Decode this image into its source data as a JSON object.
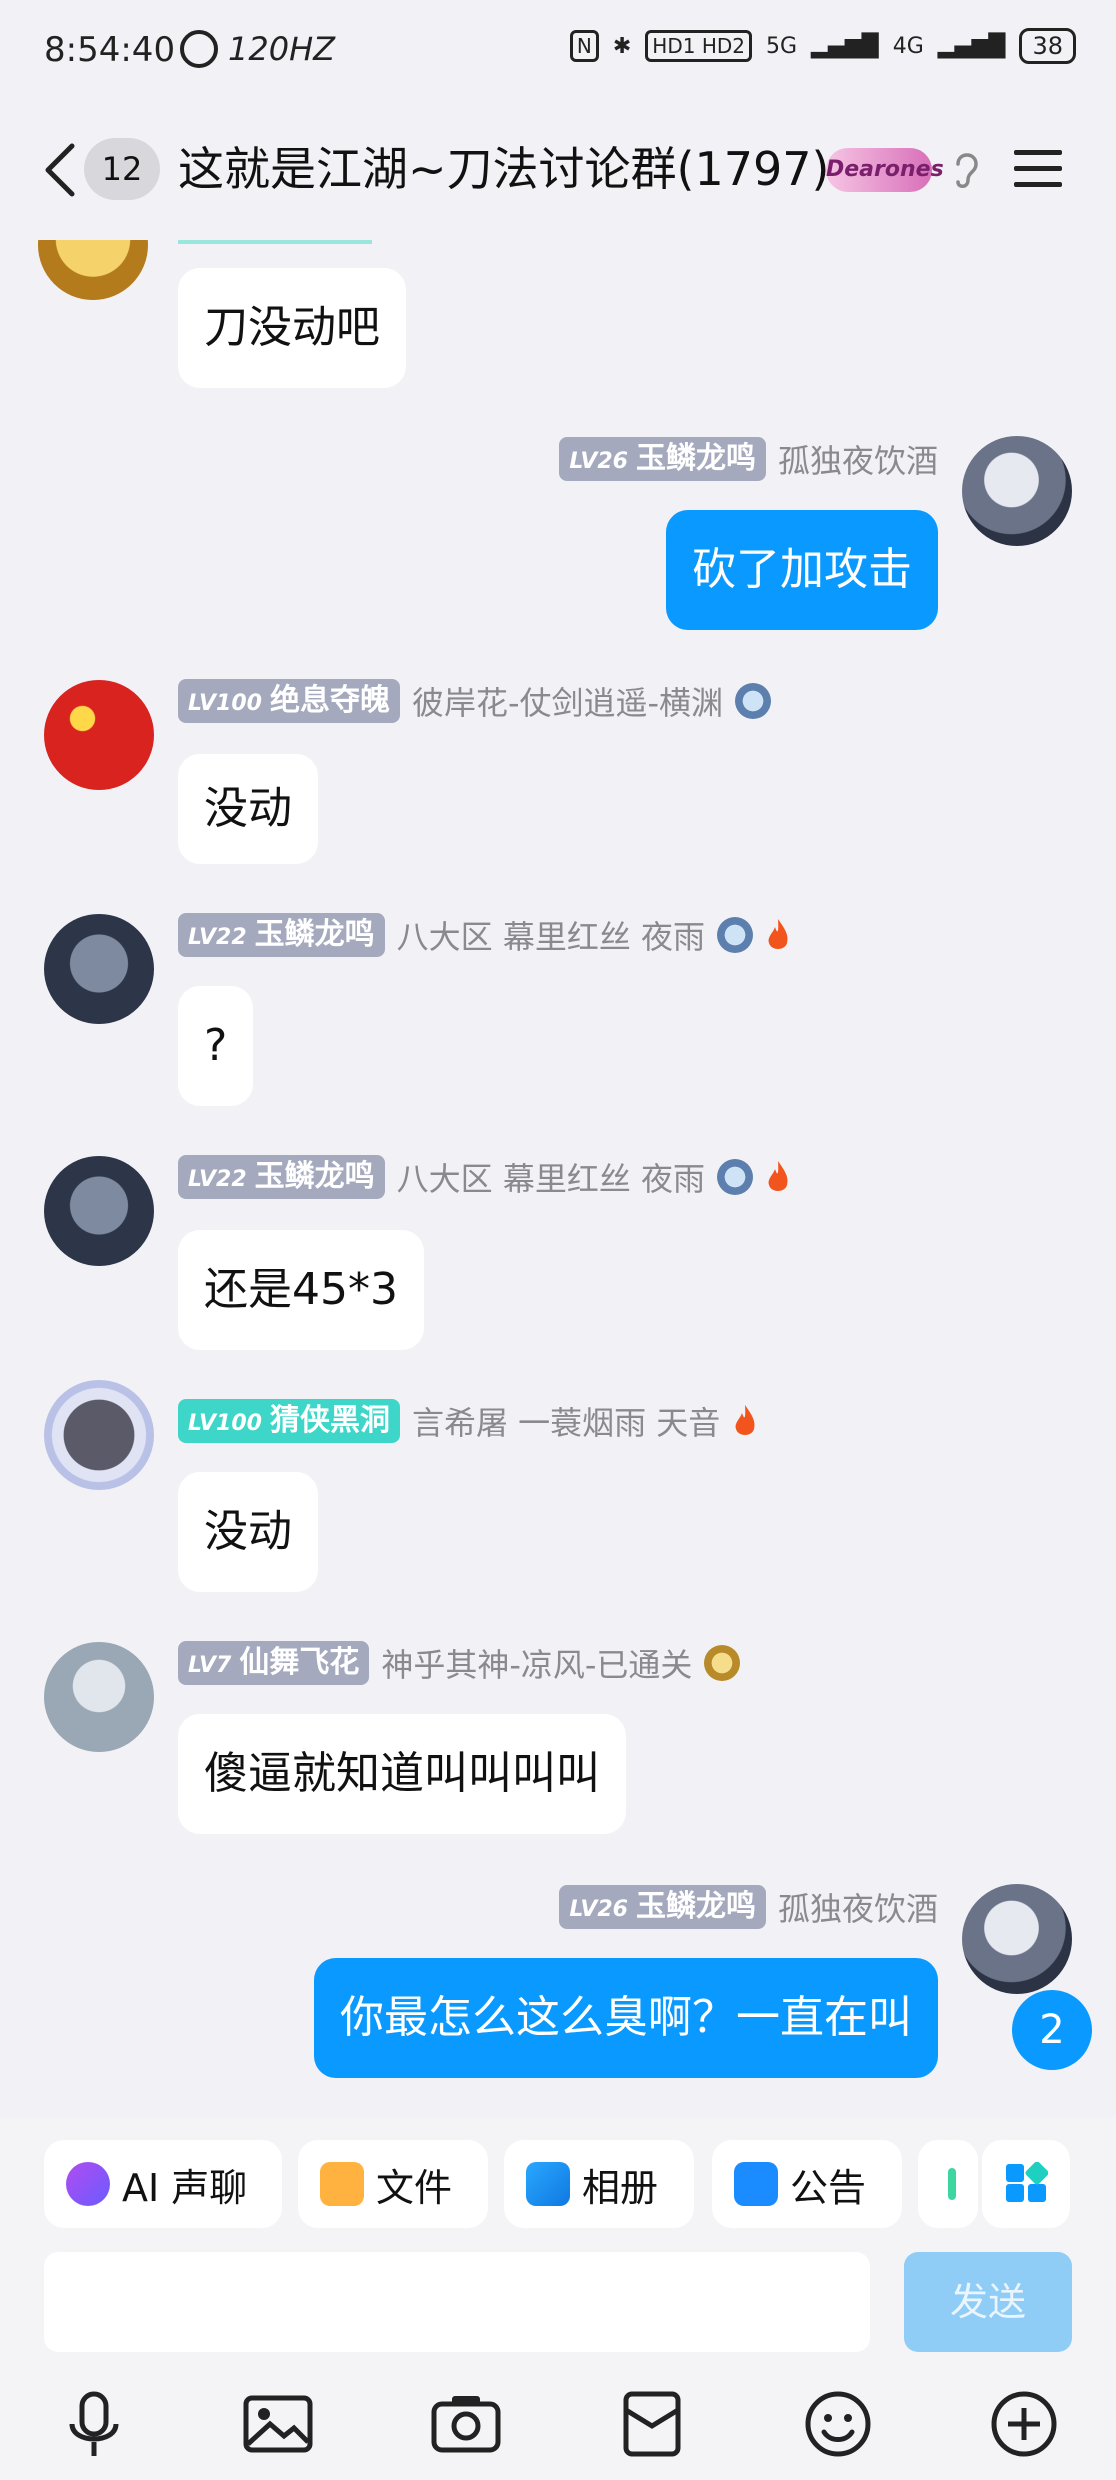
{
  "status_bar": {
    "time": "8:54:40",
    "refresh": "120HZ",
    "net1": "HD1 HD2",
    "net2": "5G",
    "net3": "4G",
    "battery": "38"
  },
  "header": {
    "unread": "12",
    "title": "这就是江湖~刀法讨论群(1797)",
    "badge": "Dearones"
  },
  "messages": [
    {
      "text": "刀没动吧"
    },
    {
      "level": "LV26",
      "nick": "玉鳞龙鸣",
      "title": "孤独夜饮酒",
      "text": "砍了加攻击"
    },
    {
      "level": "LV100",
      "nick": "绝息夺魄",
      "title": "彼岸花-仗剑逍遥-横渊",
      "text": "没动"
    },
    {
      "level": "LV22",
      "nick": "玉鳞龙鸣",
      "title": "八大区 幕里红丝 夜雨",
      "text": "?"
    },
    {
      "level": "LV22",
      "nick": "玉鳞龙鸣",
      "title": "八大区 幕里红丝 夜雨",
      "text": "还是45*3"
    },
    {
      "level": "LV100",
      "nick": "猜侠黑洞",
      "title": "言希屠  一蓑烟雨  天音",
      "text": "没动"
    },
    {
      "level": "LV7",
      "nick": "仙舞飞花",
      "title": "神乎其神-凉风-已通关",
      "text": "傻逼就知道叫叫叫叫"
    },
    {
      "level": "LV26",
      "nick": "玉鳞龙鸣",
      "title": "孤独夜饮酒",
      "text": "你最怎么这么臭啊？一直在叫"
    }
  ],
  "new_message_count": "2",
  "quick_actions": [
    {
      "label": "AI 声聊",
      "icon": "ai-voice-icon"
    },
    {
      "label": "文件",
      "icon": "folder-icon"
    },
    {
      "label": "相册",
      "icon": "album-icon"
    },
    {
      "label": "公告",
      "icon": "announcement-icon"
    }
  ],
  "composer": {
    "send_label": "发送"
  },
  "bottom_bar": [
    "microphone-icon",
    "image-icon",
    "camera-icon",
    "red-packet-icon",
    "emoji-icon",
    "plus-icon"
  ],
  "colors": {
    "primary": "#0a99ff",
    "send_disabled": "#8fcdf7",
    "level_badge": "#a5a9bd",
    "level_badge_vip": "#3dd6c8",
    "background": "#f2f2f6"
  }
}
